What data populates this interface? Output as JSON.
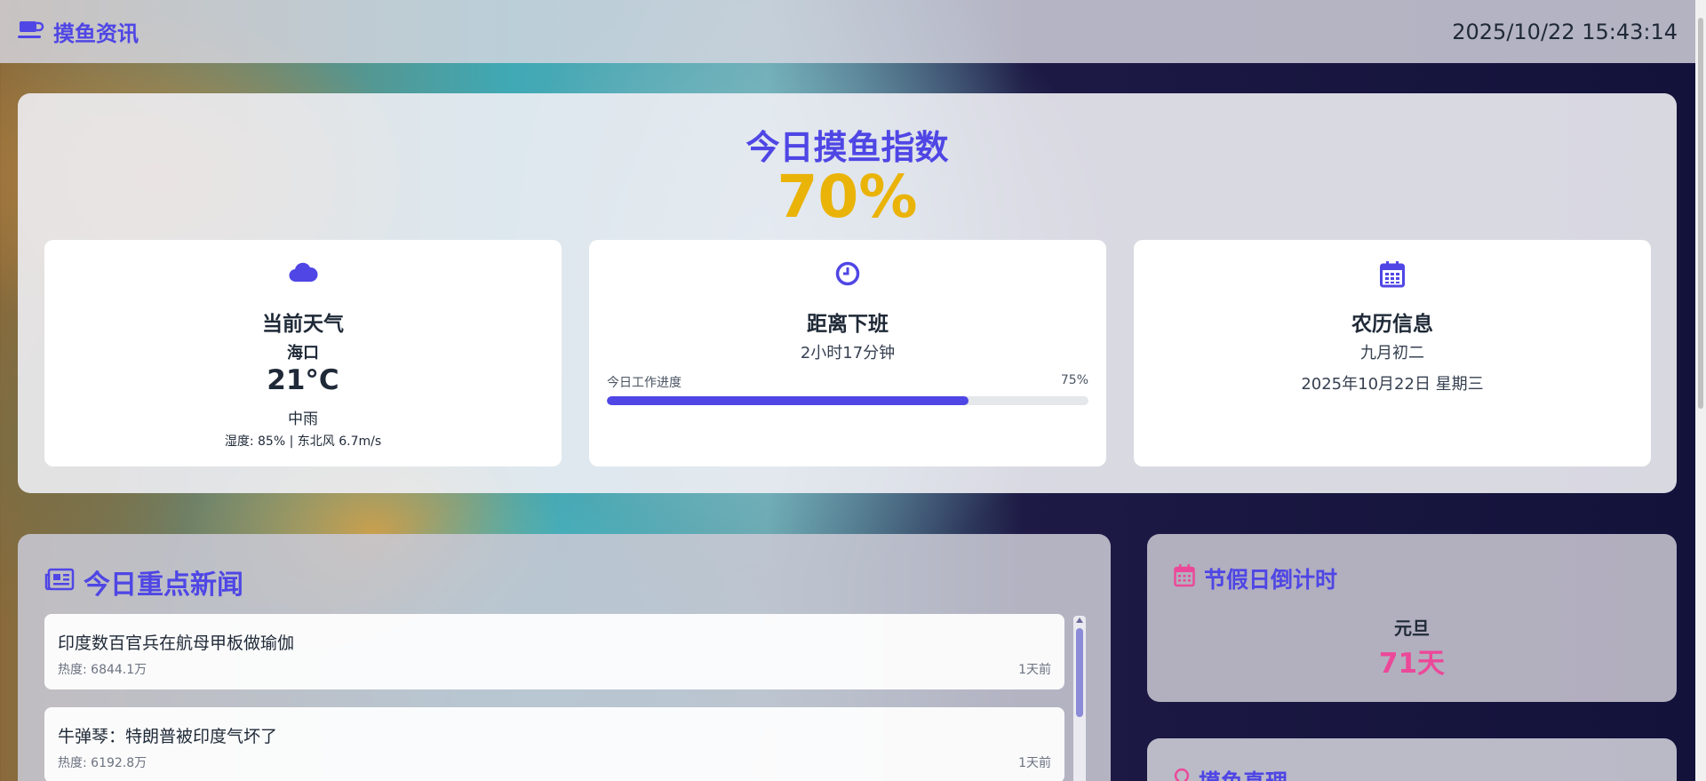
{
  "header": {
    "brand": "摸鱼资讯",
    "clock": "2025/10/22 15:43:14"
  },
  "hero": {
    "title": "今日摸鱼指数",
    "value": "70%"
  },
  "weather": {
    "title": "当前天气",
    "city": "海口",
    "temp": "21°C",
    "desc": "中雨",
    "meta": "湿度: 85% | 东北风 6.7m/s"
  },
  "offwork": {
    "title": "距离下班",
    "remaining": "2小时17分钟",
    "progress_label": "今日工作进度",
    "progress_text": "75%",
    "progress_value": 75
  },
  "lunar": {
    "title": "农历信息",
    "lunar_date": "九月初二",
    "solar_date": "2025年10月22日 星期三"
  },
  "news": {
    "title": "今日重点新闻",
    "items": [
      {
        "title": "印度数百官兵在航母甲板做瑜伽",
        "heat": "热度: 6844.1万",
        "time": "1天前"
      },
      {
        "title": "牛弹琴：特朗普被印度气坏了",
        "heat": "热度: 6192.8万",
        "time": "1天前"
      }
    ]
  },
  "holiday": {
    "title": "节假日倒计时",
    "name": "元旦",
    "days": "71天"
  },
  "quote": {
    "title": "摸鱼真理"
  },
  "colors": {
    "accent": "#4f46e5",
    "highlight": "#eab308",
    "pink": "#ec4899"
  }
}
